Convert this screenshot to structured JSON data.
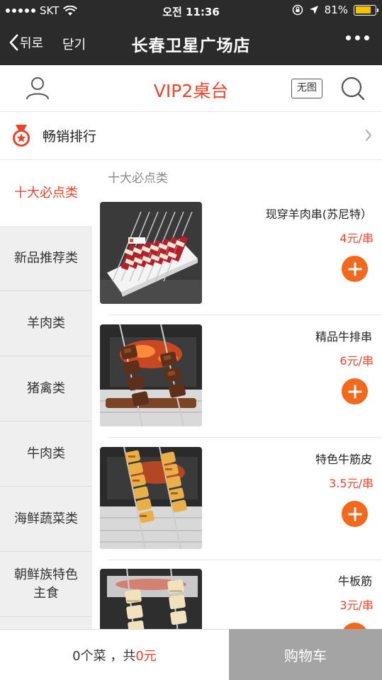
{
  "status_bar": {
    "carrier": "SKT",
    "time": "오전 11:36",
    "battery": "81%",
    "battery_level": 0.81,
    "battery_color": "#f5c20a"
  },
  "nav": {
    "back_label": "뒤로",
    "close_label": "닫기",
    "title": "长春卫星广场店"
  },
  "header": {
    "table_title": "VIP2桌台",
    "no_image_label": "无图"
  },
  "bestseller": {
    "label": "畅销排行"
  },
  "sidebar": {
    "categories": [
      {
        "label": "十大必点类",
        "active": true
      },
      {
        "label": "新品推荐类"
      },
      {
        "label": "羊肉类"
      },
      {
        "label": "猪禽类"
      },
      {
        "label": "牛肉类"
      },
      {
        "label": "海鲜蔬菜类"
      },
      {
        "label": "朝鲜族特色主食"
      }
    ]
  },
  "main": {
    "section_title": "十大必点类",
    "items": [
      {
        "name": "现穿羊肉串(苏尼特）",
        "price": "4元/串"
      },
      {
        "name": "精品牛排串",
        "price": "6元/串"
      },
      {
        "name": "特色牛筋皮",
        "price": "3.5元/串"
      },
      {
        "name": "牛板筋",
        "price": "3元/串"
      }
    ]
  },
  "cart": {
    "count_text": "0个菜",
    "separator": " ，共",
    "total": "0元",
    "button_label": "购物车"
  },
  "colors": {
    "accent": "#e8452d",
    "add_button": "#f2691e",
    "nav_bg": "#2b2b2b",
    "cart_button_bg": "#a4a4a4"
  }
}
